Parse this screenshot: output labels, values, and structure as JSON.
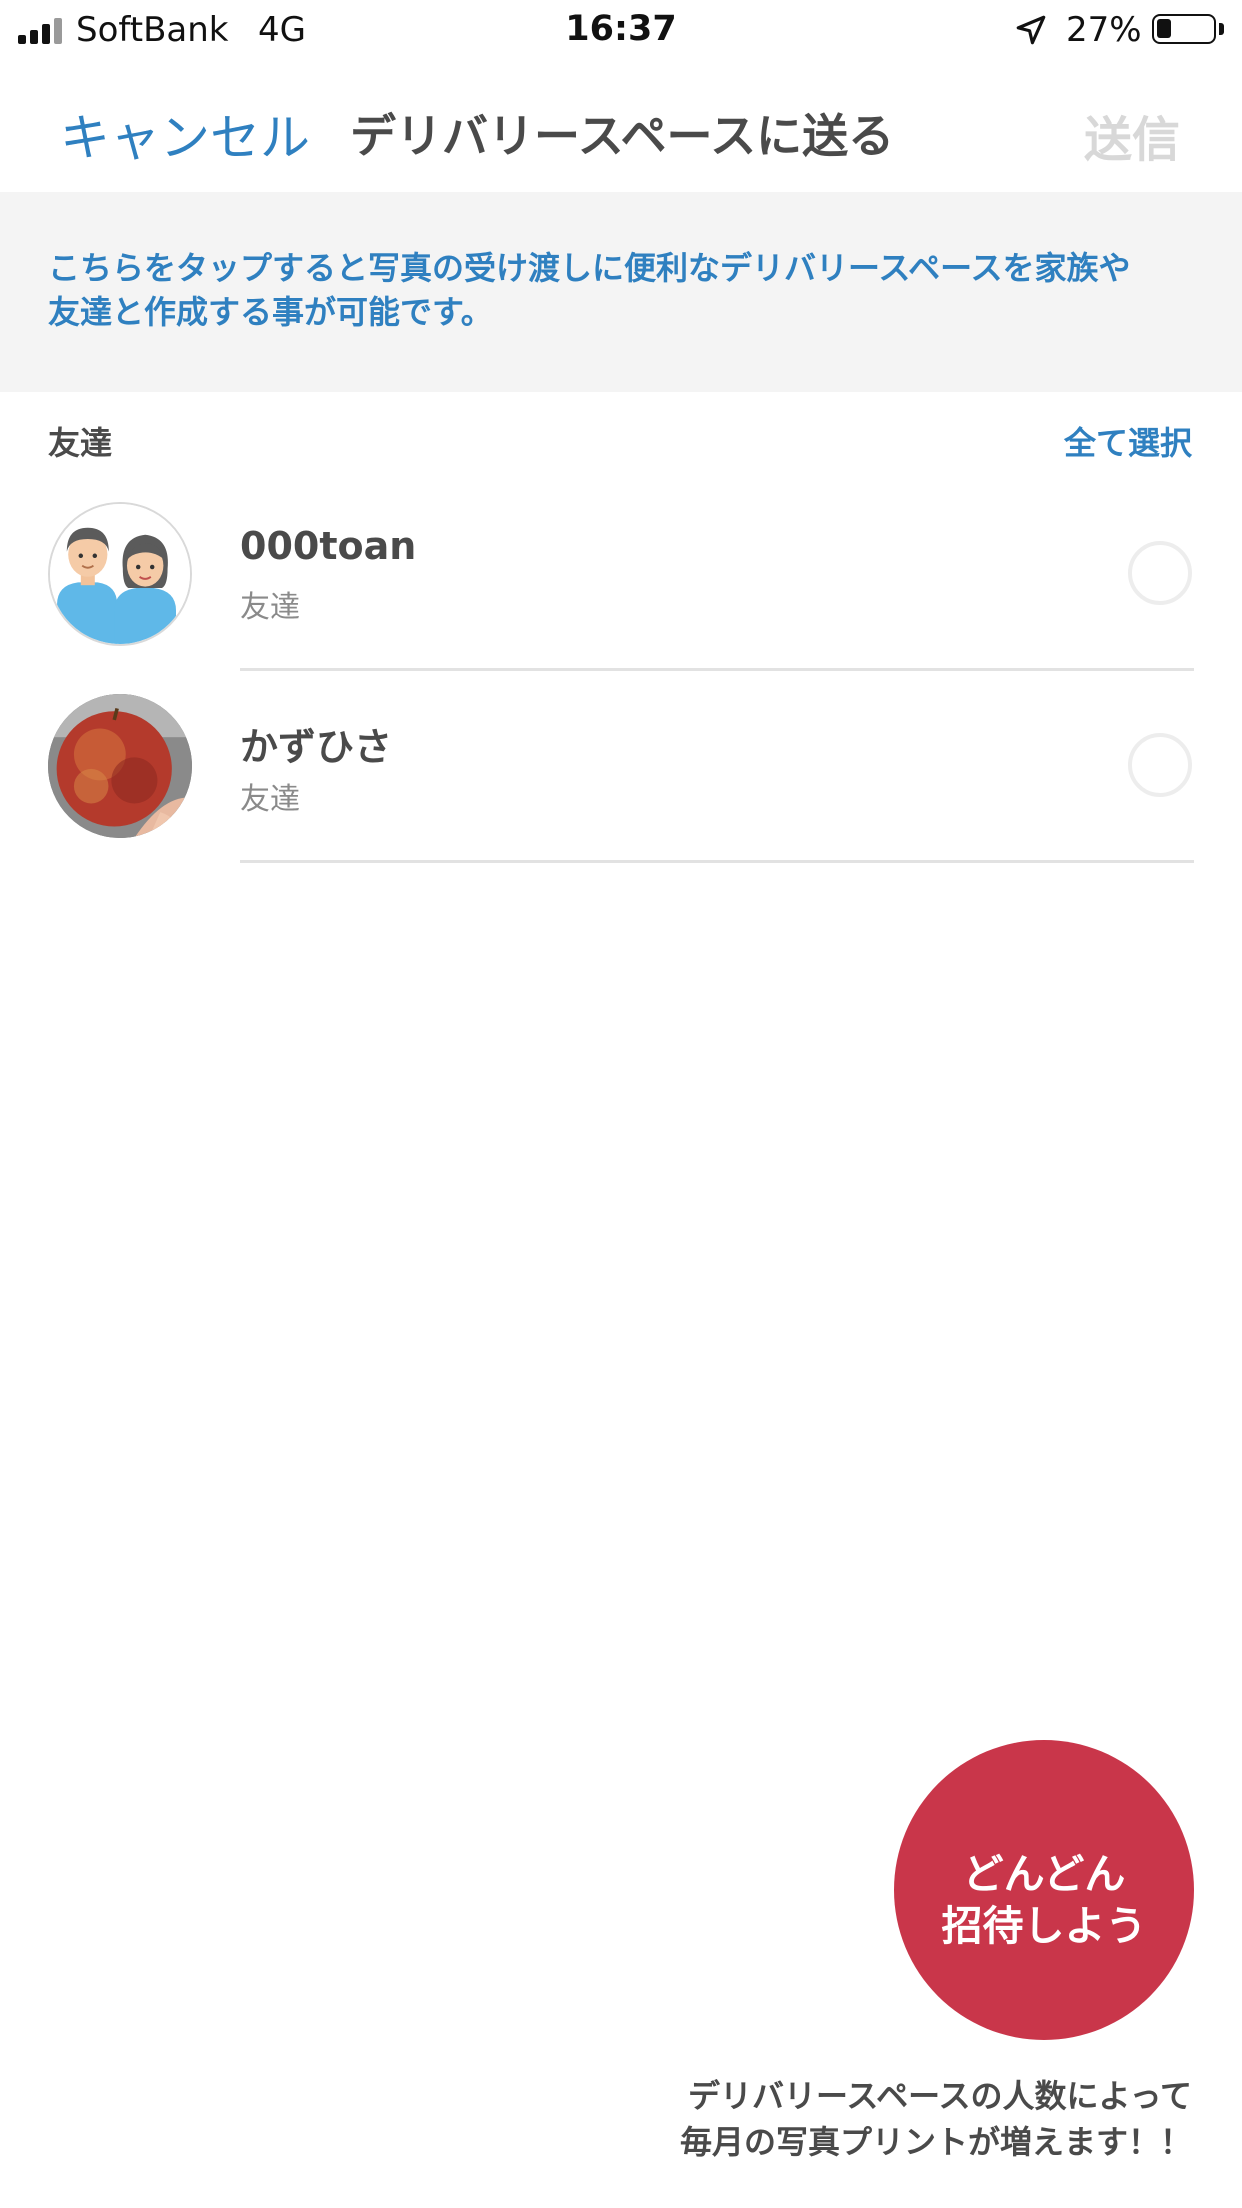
{
  "status_bar": {
    "carrier": "SoftBank",
    "network": "4G",
    "time": "16:37",
    "battery_percent": "27%",
    "battery_level": 0.27,
    "location_icon": "location-arrow-icon",
    "signal_icon": "cell-signal-icon"
  },
  "nav": {
    "cancel_label": "キャンセル",
    "title": "デリバリースペースに送る",
    "send_label": "送信"
  },
  "info_banner": {
    "line1": "こちらをタップすると写真の受け渡しに便利なデリバリースペースを家族や",
    "line2": "友達と作成する事が可能です。"
  },
  "section": {
    "title": "友達",
    "select_all_label": "全て選択"
  },
  "friends": [
    {
      "name": "000toan",
      "relation": "友達",
      "avatar": "users-avatar-icon",
      "selected": false
    },
    {
      "name": "かずひさ",
      "relation": "友達",
      "avatar": "apple-photo",
      "selected": false
    }
  ],
  "invite": {
    "line1": "どんどん",
    "line2": "招待しよう"
  },
  "footer_note": {
    "line1": "デリバリースペースの人数によって",
    "line2": "毎月の写真プリントが増えます！！"
  },
  "colors": {
    "accent_blue": "#2f80c0",
    "invite_red": "#c9364a",
    "banner_bg": "#f4f4f4",
    "disabled_text": "#d8d8d8"
  }
}
